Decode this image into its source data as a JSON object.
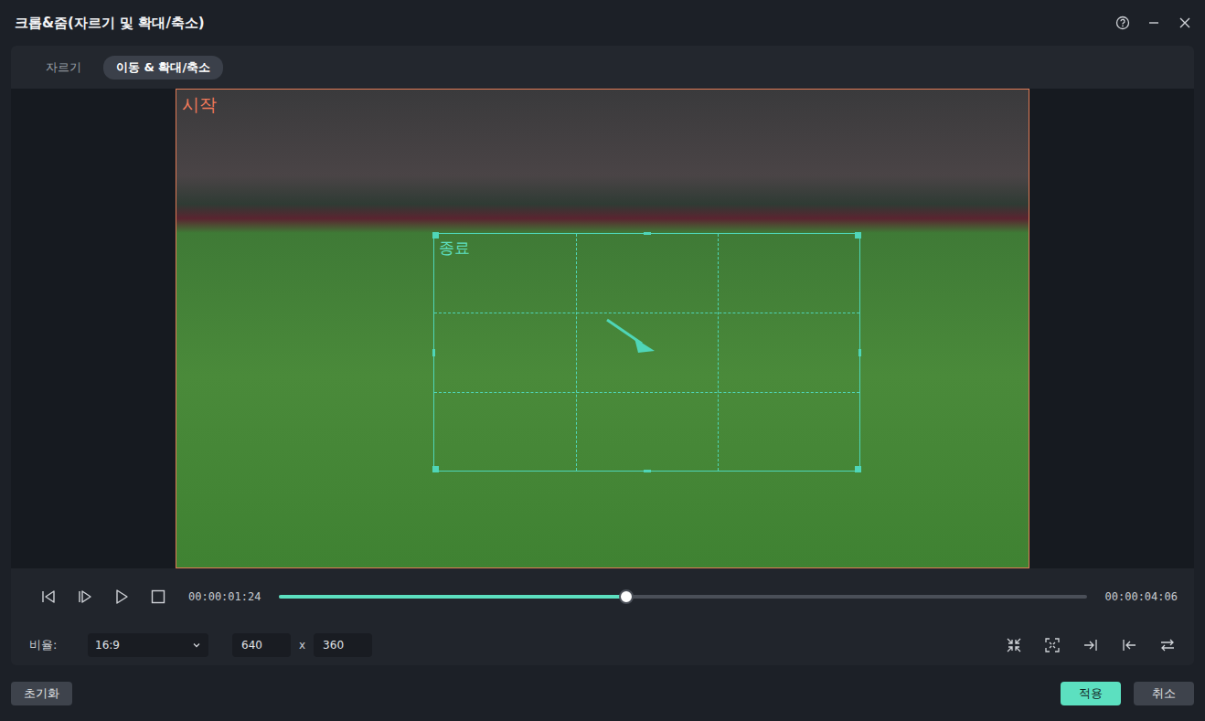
{
  "window": {
    "title": "크롭&줌(자르기 및 확대/축소)"
  },
  "tabs": [
    {
      "label": "자르기",
      "selected": false
    },
    {
      "label": "이동 & 확대/축소",
      "selected": true
    }
  ],
  "preview": {
    "start_label": "시작",
    "end_label": "종료"
  },
  "playback": {
    "current_time": "00:00:01:24",
    "total_time": "00:00:04:06",
    "level": 0.429
  },
  "ratio": {
    "label": "비율:",
    "value": "16:9",
    "width": "640",
    "separator": "x",
    "height": "360"
  },
  "buttons": {
    "reset": "초기화",
    "apply": "적용",
    "cancel": "취소"
  }
}
